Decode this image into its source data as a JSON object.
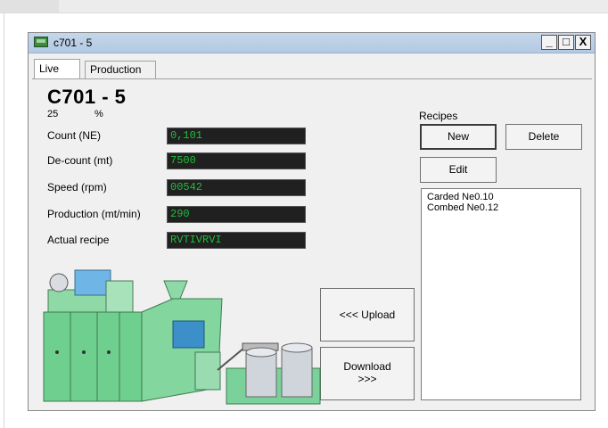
{
  "window": {
    "title": "c701 - 5",
    "minimize_label": "_",
    "maximize_label": "□",
    "close_label": "X"
  },
  "tabs": [
    {
      "label": "Live",
      "active": true
    },
    {
      "label": "Production",
      "active": false
    }
  ],
  "machine": {
    "title": "C701 - 5",
    "percent_value": "25",
    "percent_unit": "%"
  },
  "fields": [
    {
      "label": "Count (NE)",
      "value": "0,101"
    },
    {
      "label": "De-count (mt)",
      "value": "7500"
    },
    {
      "label": "Speed (rpm)",
      "value": "00542"
    },
    {
      "label": "Production (mt/min)",
      "value": "290"
    },
    {
      "label": "Actual recipe",
      "value": "RVTIVRVI"
    }
  ],
  "recipes": {
    "label": "Recipes",
    "new_label": "New",
    "delete_label": "Delete",
    "edit_label": "Edit",
    "items": [
      "Carded Ne0.10",
      "Combed Ne0.12"
    ]
  },
  "actions": {
    "upload_label": "<<< Upload",
    "download_label_line1": "Download",
    "download_label_line2": ">>>"
  },
  "colors": {
    "value_text": "#1fbf3a",
    "value_bg": "#202020",
    "machine_body": "#6fcf8f"
  }
}
